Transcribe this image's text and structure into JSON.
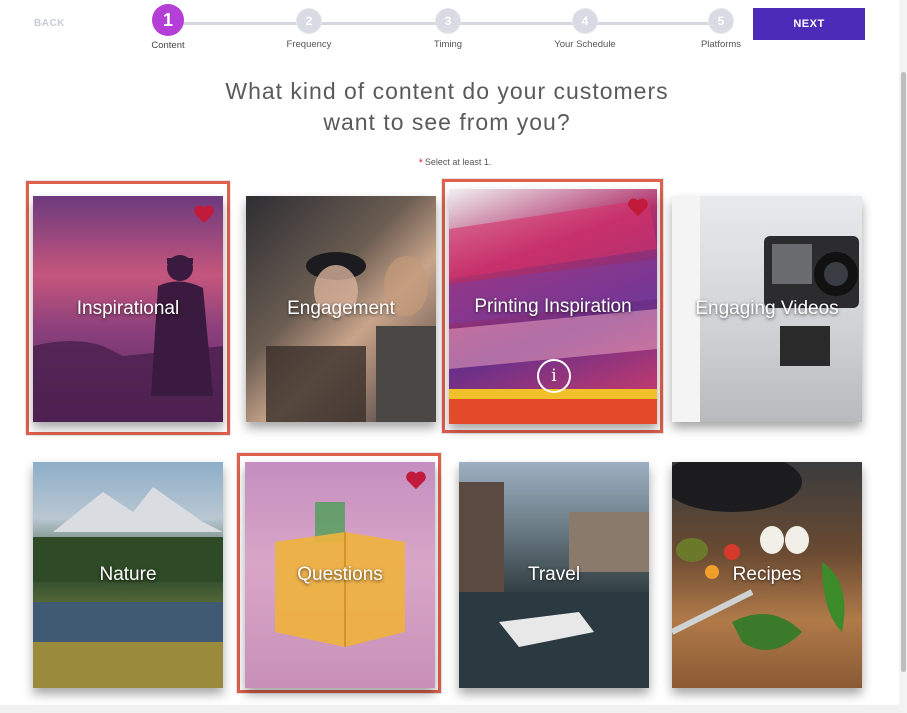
{
  "nav": {
    "back_label": "BACK",
    "next_label": "NEXT"
  },
  "steps": [
    {
      "number": "1",
      "label": "Content",
      "active": true
    },
    {
      "number": "2",
      "label": "Frequency"
    },
    {
      "number": "3",
      "label": "Timing"
    },
    {
      "number": "4",
      "label": "Your Schedule"
    },
    {
      "number": "5",
      "label": "Platforms"
    }
  ],
  "question": {
    "line1": "What kind of content do your customers",
    "line2": "want to see from you?"
  },
  "hint": {
    "required_mark": "*",
    "text": "Select at least 1."
  },
  "tiles": [
    {
      "label": "Inspirational",
      "selected": true,
      "favorite": true
    },
    {
      "label": "Engagement",
      "selected": false,
      "favorite": false
    },
    {
      "label": "Printing Inspiration",
      "selected": true,
      "favorite": true,
      "info": "i"
    },
    {
      "label": "Engaging Videos",
      "selected": false,
      "favorite": false
    },
    {
      "label": "Nature",
      "selected": false,
      "favorite": false
    },
    {
      "label": "Questions",
      "selected": true,
      "favorite": true
    },
    {
      "label": "Travel",
      "selected": false,
      "favorite": false
    },
    {
      "label": "Recipes",
      "selected": false,
      "favorite": false
    }
  ],
  "colors": {
    "accent": "#4b2bb8",
    "step_active": "#b33fd6",
    "selection_border": "#e0604e",
    "heart": "#c21a3a"
  }
}
